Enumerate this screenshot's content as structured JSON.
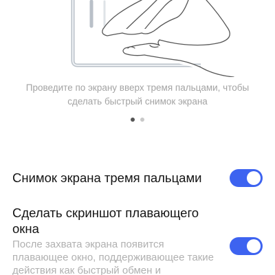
{
  "screen": {
    "caption": "Проведите по экрану вверх тремя пальцами, чтобы сделать быстрый снимок экрана"
  },
  "carousel": {
    "pages": 2,
    "active_index": 0
  },
  "settings": [
    {
      "title": "Снимок экрана тремя пальцами",
      "enabled": true
    },
    {
      "title": "Сделать скриншот плавающего окна",
      "description": "После захвата экрана появится плавающее окно, поддерживающее такие действия как быстрый обмен и",
      "enabled": true
    }
  ],
  "colors": {
    "accent": "#3d63f0",
    "caption_text": "#a3a3a3",
    "secondary_text": "#b0b0b0"
  }
}
